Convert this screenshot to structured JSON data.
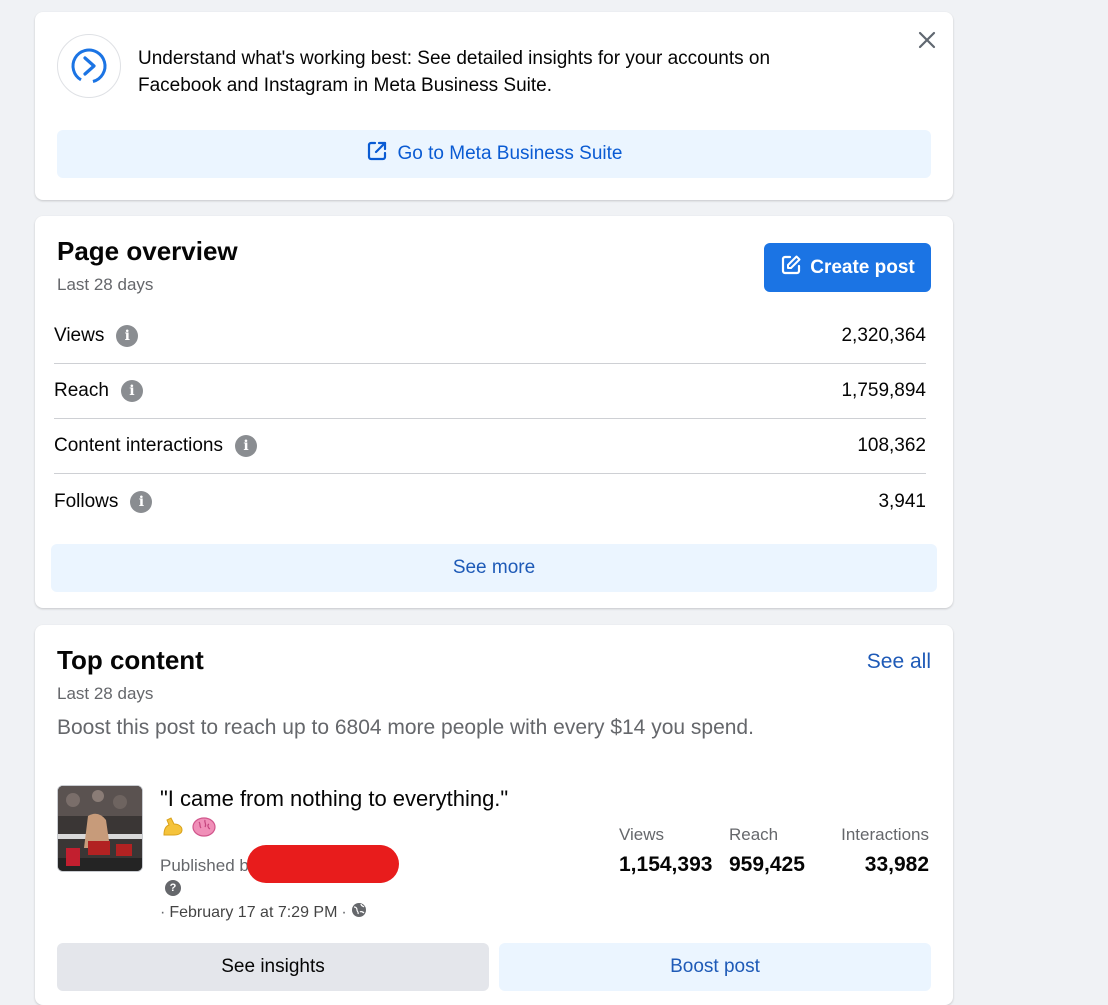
{
  "banner": {
    "message": "Understand what's working best: See detailed insights for your accounts on Facebook and Instagram in Meta Business Suite.",
    "button_label": "Go to Meta Business Suite"
  },
  "overview": {
    "title": "Page overview",
    "subtitle": "Last 28 days",
    "create_post_label": "Create post",
    "metrics": [
      {
        "label": "Views",
        "value": "2,320,364"
      },
      {
        "label": "Reach",
        "value": "1,759,894"
      },
      {
        "label": "Content interactions",
        "value": "108,362"
      },
      {
        "label": "Follows",
        "value": "3,941"
      }
    ],
    "see_more_label": "See more"
  },
  "top_content": {
    "title": "Top content",
    "subtitle": "Last 28 days",
    "see_all_label": "See all",
    "boost_message": "Boost this post to reach up to 6804 more people with every $14 you spend.",
    "post": {
      "text": "\"I came from nothing to everything.\"",
      "emojis": [
        "flexed-biceps-emoji",
        "brain-emoji"
      ],
      "published_prefix": "Published b",
      "date": "February 17 at 7:29 PM",
      "stats": [
        {
          "label": "Views",
          "value": "1,154,393"
        },
        {
          "label": "Reach",
          "value": "959,425"
        },
        {
          "label": "Interactions",
          "value": "33,982"
        }
      ]
    },
    "see_insights_label": "See insights",
    "boost_post_label": "Boost post"
  },
  "colors": {
    "background": "#f0f2f5",
    "primary_blue": "#1b74e4",
    "link_blue": "#1e5ab7",
    "light_blue_button": "#ebf5ff",
    "gray_button": "#e4e6eb",
    "secondary_text": "#65676b",
    "redaction": "#e81c1c"
  }
}
